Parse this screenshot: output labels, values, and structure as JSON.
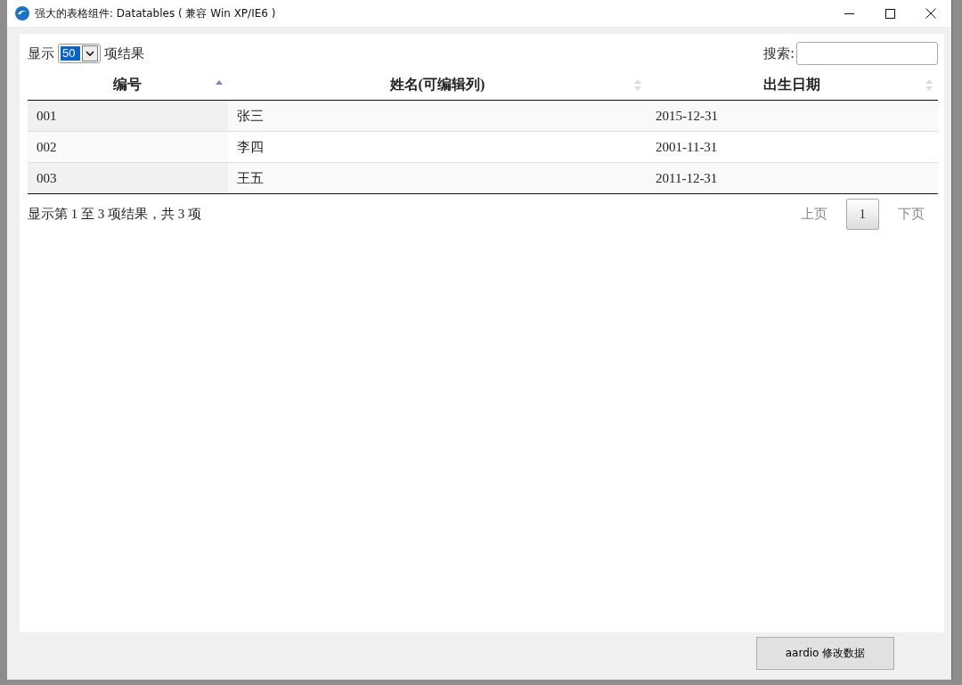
{
  "window": {
    "title": "强大的表格组件: Datatables ( 兼容 Win XP/IE6 )"
  },
  "length_menu": {
    "label_before": "显示",
    "value": "50",
    "label_after": "项结果"
  },
  "search": {
    "label": "搜索:"
  },
  "table": {
    "columns": [
      {
        "label": "编号",
        "sorted": true
      },
      {
        "label": "姓名(可编辑列)",
        "sorted": false
      },
      {
        "label": "出生日期",
        "sorted": false
      }
    ],
    "rows": [
      [
        "001",
        "张三",
        "2015-12-31"
      ],
      [
        "002",
        "李四",
        "2001-11-31"
      ],
      [
        "003",
        "王五",
        "2011-12-31"
      ]
    ]
  },
  "info": "显示第 1 至 3 项结果，共 3 项",
  "pagination": {
    "previous": {
      "label": "上页",
      "disabled": true
    },
    "pages": [
      {
        "label": "1",
        "selected": true
      }
    ],
    "next": {
      "label": "下页",
      "disabled": true
    }
  },
  "button": {
    "label": "aardio 修改数据"
  }
}
